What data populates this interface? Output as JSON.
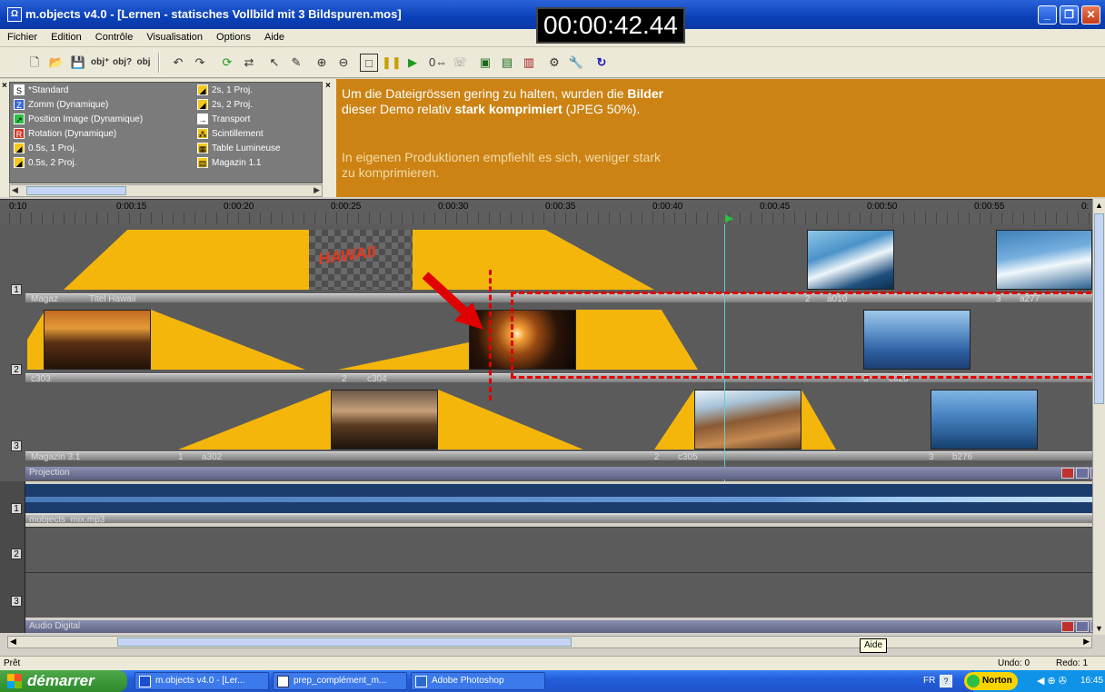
{
  "window": {
    "title": "m.objects v4.0 - [Lernen - statisches Vollbild mit 3 Bildspuren.mos]",
    "timecode": "00:00:42.44",
    "app_icon": "mobjects-logo-icon",
    "controls": [
      "minimize-icon",
      "restore-icon",
      "close-icon"
    ]
  },
  "menu": [
    "Fichier",
    "Edition",
    "Contrôle",
    "Visualisation",
    "Options",
    "Aide"
  ],
  "toolbar": {
    "icons": [
      "new-icon",
      "open-icon",
      "save-icon",
      "obj-add-icon",
      "obj-help-icon",
      "obj-icon",
      "undo-icon",
      "redo-icon",
      "refresh-icon",
      "sync-icon",
      "pointer-icon",
      "pen-icon",
      "zoom-in-icon",
      "zoom-out-icon",
      "frame-icon",
      "pause-icon",
      "play-icon",
      "counter-icon",
      "comment-icon",
      "image-icon",
      "projector-icon",
      "film-icon",
      "settings-icon",
      "wrench-icon",
      "loop-icon"
    ]
  },
  "effects": {
    "col1": [
      "*Standard",
      "Zomm (Dynamique)",
      "Position Image (Dynamique)",
      "Rotation (Dynamique)",
      "0.5s, 1 Proj.",
      "0.5s, 2 Proj."
    ],
    "col2": [
      "2s, 1 Proj.",
      "2s, 2 Proj.",
      "Transport",
      "Scintillement",
      "Table Lumineuse",
      "Magazin 1.1"
    ]
  },
  "info": {
    "p1_a": "Um die Dateigrössen gering zu halten, wurden die ",
    "p1_b": "Bilder",
    "p1_c": " dieser Demo relativ ",
    "p1_d": "stark komprimiert",
    "p1_e": " (JPEG 50%).",
    "p2": "In eigenen Produktionen empfiehlt es sich, weniger stark zu komprimieren."
  },
  "ruler": [
    "0:10",
    "0:00:15",
    "0:00:20",
    "0:00:25",
    "0:00:30",
    "0:00:35",
    "0:00:40",
    "0:00:45",
    "0:00:50",
    "0:00:55",
    "0:"
  ],
  "tracks": {
    "t1": {
      "num": "1",
      "label_a": "Magaz",
      "label_b": "Titel Hawaii",
      "c2": "2",
      "c2n": "a010",
      "c3": "3",
      "c3n": "a277",
      "overlay": "HAWAII"
    },
    "t2": {
      "num": "2",
      "label": "c303",
      "c2": "2",
      "c2n": "c304",
      "c3": "3",
      "c3n": "c025"
    },
    "t3": {
      "num": "3",
      "label": "Magazin 3.1",
      "c1": "1",
      "c1n": "a302",
      "c2": "2",
      "c2n": "c305",
      "c3": "3",
      "c3n": "b276"
    }
  },
  "sections": {
    "projection": "Projection",
    "audio": "Audio Digital"
  },
  "audio": {
    "file": "mobjects_mix.mp3",
    "lanes": [
      "1",
      "2",
      "3"
    ]
  },
  "tooltip": "Aide",
  "status": {
    "ready": "Prêt",
    "undo": "Undo: 0",
    "redo": "Redo: 1"
  },
  "taskbar": {
    "start": "démarrer",
    "tasks": [
      "m.objects v4.0 - [Ler...",
      "prep_complément_m...",
      "Adobe Photoshop"
    ],
    "lang": "FR",
    "norton": "Norton",
    "clock": "16:45"
  },
  "colors": {
    "accent_orange": "#cc8314",
    "clip_yellow": "#f5b60b",
    "highlight_red": "#e00000"
  }
}
